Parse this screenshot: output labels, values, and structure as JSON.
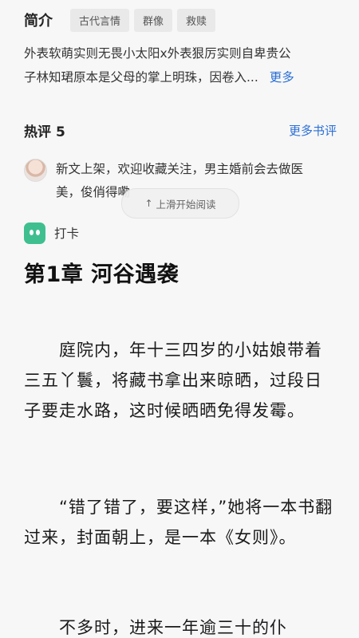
{
  "intro": {
    "title": "简介",
    "tags": [
      "古代言情",
      "群像",
      "救赎"
    ],
    "lines": [
      "外表软萌实则无畏小太阳x外表狠厉实则自卑贵公",
      "子林知珺原本是父母的掌上明珠，因卷入..."
    ],
    "more": "更多"
  },
  "reviews": {
    "title": "热评",
    "count": "5",
    "more": "更多书评",
    "items": [
      {
        "avatar": "girl-avatar",
        "text": "新文上架，欢迎收藏关注，男主婚前会去做医美，俊俏得嘞"
      },
      {
        "avatar": "robot-avatar",
        "text": "打卡"
      }
    ]
  },
  "toast": {
    "icon": "arrow-up-icon",
    "text": "上滑开始阅读"
  },
  "chapter": {
    "title": "第1章 河谷遇袭",
    "paragraphs": [
      "　　庭院内，年十三四岁的小姑娘带着三五丫鬟，将藏书拿出来晾晒，过段日子要走水路，这时候晒晒免得发霉。",
      "　　“错了错了，要这样，”她将一本书翻过来，封面朝上，是一本《女则》。",
      "　　不多时，进来一年逾三十的仆"
    ]
  },
  "colors": {
    "accent": "#2b6fd6",
    "background": "#f7f7f7",
    "tag_bg": "#e9e9e9"
  }
}
